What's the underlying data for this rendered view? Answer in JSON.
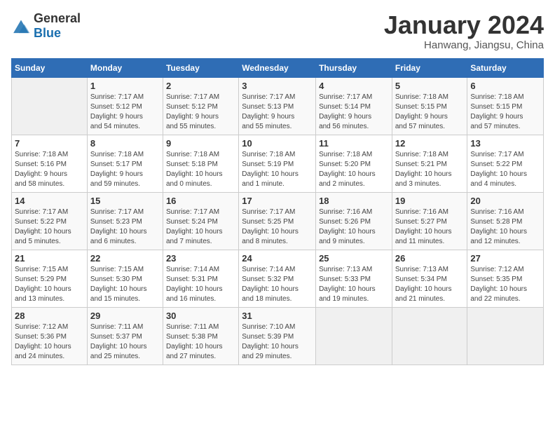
{
  "header": {
    "logo": {
      "general": "General",
      "blue": "Blue"
    },
    "title": "January 2024",
    "subtitle": "Hanwang, Jiangsu, China"
  },
  "weekdays": [
    "Sunday",
    "Monday",
    "Tuesday",
    "Wednesday",
    "Thursday",
    "Friday",
    "Saturday"
  ],
  "weeks": [
    [
      {
        "day": "",
        "info": ""
      },
      {
        "day": "1",
        "info": "Sunrise: 7:17 AM\nSunset: 5:12 PM\nDaylight: 9 hours\nand 54 minutes."
      },
      {
        "day": "2",
        "info": "Sunrise: 7:17 AM\nSunset: 5:12 PM\nDaylight: 9 hours\nand 55 minutes."
      },
      {
        "day": "3",
        "info": "Sunrise: 7:17 AM\nSunset: 5:13 PM\nDaylight: 9 hours\nand 55 minutes."
      },
      {
        "day": "4",
        "info": "Sunrise: 7:17 AM\nSunset: 5:14 PM\nDaylight: 9 hours\nand 56 minutes."
      },
      {
        "day": "5",
        "info": "Sunrise: 7:18 AM\nSunset: 5:15 PM\nDaylight: 9 hours\nand 57 minutes."
      },
      {
        "day": "6",
        "info": "Sunrise: 7:18 AM\nSunset: 5:15 PM\nDaylight: 9 hours\nand 57 minutes."
      }
    ],
    [
      {
        "day": "7",
        "info": "Sunrise: 7:18 AM\nSunset: 5:16 PM\nDaylight: 9 hours\nand 58 minutes."
      },
      {
        "day": "8",
        "info": "Sunrise: 7:18 AM\nSunset: 5:17 PM\nDaylight: 9 hours\nand 59 minutes."
      },
      {
        "day": "9",
        "info": "Sunrise: 7:18 AM\nSunset: 5:18 PM\nDaylight: 10 hours\nand 0 minutes."
      },
      {
        "day": "10",
        "info": "Sunrise: 7:18 AM\nSunset: 5:19 PM\nDaylight: 10 hours\nand 1 minute."
      },
      {
        "day": "11",
        "info": "Sunrise: 7:18 AM\nSunset: 5:20 PM\nDaylight: 10 hours\nand 2 minutes."
      },
      {
        "day": "12",
        "info": "Sunrise: 7:18 AM\nSunset: 5:21 PM\nDaylight: 10 hours\nand 3 minutes."
      },
      {
        "day": "13",
        "info": "Sunrise: 7:17 AM\nSunset: 5:22 PM\nDaylight: 10 hours\nand 4 minutes."
      }
    ],
    [
      {
        "day": "14",
        "info": "Sunrise: 7:17 AM\nSunset: 5:22 PM\nDaylight: 10 hours\nand 5 minutes."
      },
      {
        "day": "15",
        "info": "Sunrise: 7:17 AM\nSunset: 5:23 PM\nDaylight: 10 hours\nand 6 minutes."
      },
      {
        "day": "16",
        "info": "Sunrise: 7:17 AM\nSunset: 5:24 PM\nDaylight: 10 hours\nand 7 minutes."
      },
      {
        "day": "17",
        "info": "Sunrise: 7:17 AM\nSunset: 5:25 PM\nDaylight: 10 hours\nand 8 minutes."
      },
      {
        "day": "18",
        "info": "Sunrise: 7:16 AM\nSunset: 5:26 PM\nDaylight: 10 hours\nand 9 minutes."
      },
      {
        "day": "19",
        "info": "Sunrise: 7:16 AM\nSunset: 5:27 PM\nDaylight: 10 hours\nand 11 minutes."
      },
      {
        "day": "20",
        "info": "Sunrise: 7:16 AM\nSunset: 5:28 PM\nDaylight: 10 hours\nand 12 minutes."
      }
    ],
    [
      {
        "day": "21",
        "info": "Sunrise: 7:15 AM\nSunset: 5:29 PM\nDaylight: 10 hours\nand 13 minutes."
      },
      {
        "day": "22",
        "info": "Sunrise: 7:15 AM\nSunset: 5:30 PM\nDaylight: 10 hours\nand 15 minutes."
      },
      {
        "day": "23",
        "info": "Sunrise: 7:14 AM\nSunset: 5:31 PM\nDaylight: 10 hours\nand 16 minutes."
      },
      {
        "day": "24",
        "info": "Sunrise: 7:14 AM\nSunset: 5:32 PM\nDaylight: 10 hours\nand 18 minutes."
      },
      {
        "day": "25",
        "info": "Sunrise: 7:13 AM\nSunset: 5:33 PM\nDaylight: 10 hours\nand 19 minutes."
      },
      {
        "day": "26",
        "info": "Sunrise: 7:13 AM\nSunset: 5:34 PM\nDaylight: 10 hours\nand 21 minutes."
      },
      {
        "day": "27",
        "info": "Sunrise: 7:12 AM\nSunset: 5:35 PM\nDaylight: 10 hours\nand 22 minutes."
      }
    ],
    [
      {
        "day": "28",
        "info": "Sunrise: 7:12 AM\nSunset: 5:36 PM\nDaylight: 10 hours\nand 24 minutes."
      },
      {
        "day": "29",
        "info": "Sunrise: 7:11 AM\nSunset: 5:37 PM\nDaylight: 10 hours\nand 25 minutes."
      },
      {
        "day": "30",
        "info": "Sunrise: 7:11 AM\nSunset: 5:38 PM\nDaylight: 10 hours\nand 27 minutes."
      },
      {
        "day": "31",
        "info": "Sunrise: 7:10 AM\nSunset: 5:39 PM\nDaylight: 10 hours\nand 29 minutes."
      },
      {
        "day": "",
        "info": ""
      },
      {
        "day": "",
        "info": ""
      },
      {
        "day": "",
        "info": ""
      }
    ]
  ]
}
